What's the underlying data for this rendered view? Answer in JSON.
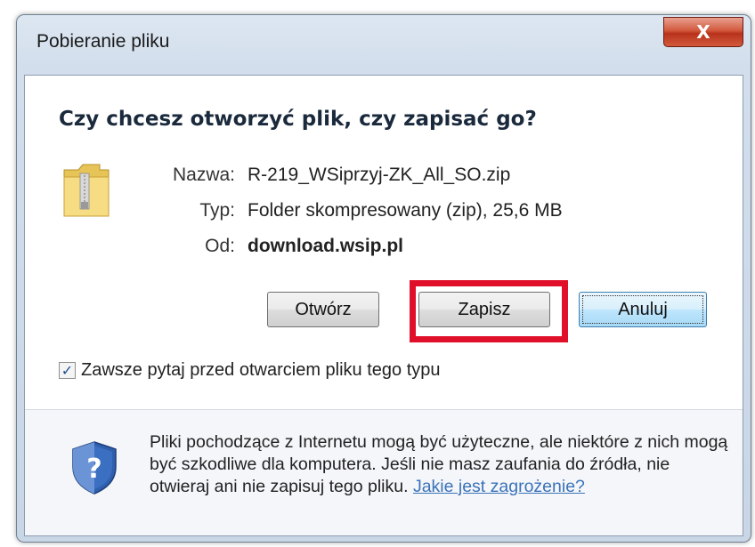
{
  "window": {
    "title": "Pobieranie pliku",
    "close_label": "X"
  },
  "dialog": {
    "question": "Czy chcesz otworzyć plik, czy zapisać go?",
    "file_icon": "zip-folder-icon",
    "fields": {
      "name_label": "Nazwa:",
      "name_value": "R-219_WSiprzyj-ZK_All_SO.zip",
      "type_label": "Typ:",
      "type_value": "Folder skompresowany (zip), 25,6 MB",
      "from_label": "Od:",
      "from_value": "download.wsip.pl"
    },
    "buttons": {
      "open_label": "Otwórz",
      "save_label": "Zapisz",
      "cancel_label": "Anuluj"
    },
    "checkbox": {
      "label": "Zawsze pytaj przed otwarciem pliku tego typu",
      "checked": true
    },
    "warning": {
      "icon": "shield-question-icon",
      "text": "Pliki pochodzące z Internetu mogą być użyteczne, ale niektóre z nich mogą być szkodliwe dla komputera. Jeśli nie masz zaufania do źródła, nie otwieraj ani nie zapisuj tego pliku.",
      "link_label": "Jakie jest zagrożenie?"
    },
    "highlight_color": "#e0102b"
  }
}
